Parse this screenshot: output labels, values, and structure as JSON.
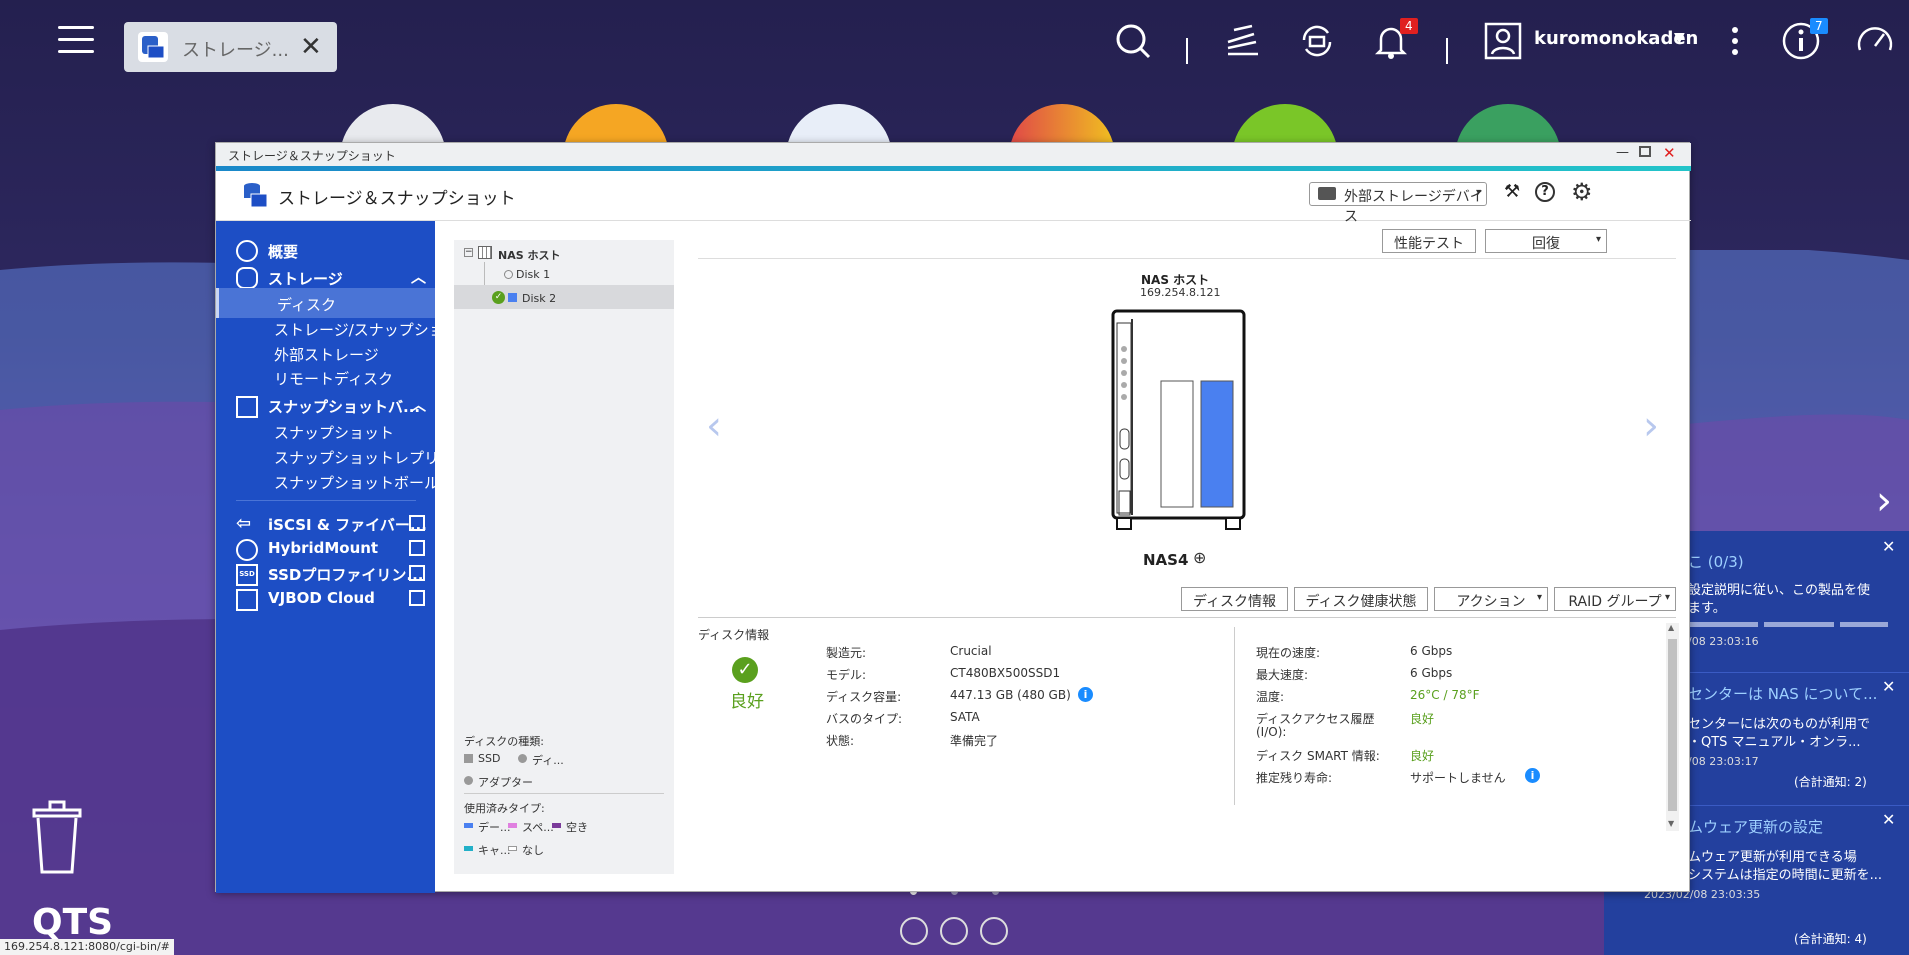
{
  "desktop": {
    "tab_label": "ストレージ...",
    "user_name": "kuromonokaden",
    "notification_count": "4",
    "info_count": "7",
    "status_url": "169.254.8.121:8080/cgi-bin/#",
    "qts_label": "QTS",
    "icons": [
      "menu-icon",
      "search-icon",
      "tasks-icon",
      "sync-icon",
      "bell-icon",
      "user-icon",
      "more-icon",
      "info-icon",
      "dashboard-icon",
      "trash-icon"
    ]
  },
  "window": {
    "title": "ストレージ＆スナップショット",
    "app_title": "ストレージ＆スナップショット",
    "external_dropdown": "外部ストレージデバイス"
  },
  "sidebar": {
    "overview": "概要",
    "storage": "ストレージ",
    "disk": "ディスク",
    "storage_snapshot": "ストレージ/スナップショ...",
    "external_storage": "外部ストレージ",
    "remote_disk": "リモートディスク",
    "snapshot_backup": "スナップショットバ...",
    "snapshot": "スナップショット",
    "snapshot_replica": "スナップショットレプリカ",
    "snapshot_vault": "スナップショットボールト",
    "iscsi": "iSCSI & ファイバー...",
    "hybridmount": "HybridMount",
    "ssd_profiling": "SSDプロファイリン...",
    "vjbod": "VJBOD Cloud"
  },
  "tree": {
    "root": "NAS ホスト",
    "disk1": "Disk 1",
    "disk2": "Disk 2",
    "disk_type_title": "ディスクの種類:",
    "ssd": "SSD",
    "di": "ディ...",
    "adapter": "アダプター",
    "used_type_title": "使用済みタイプ:",
    "data": "デー...",
    "spare": "スペ...",
    "free": "空き",
    "cache": "キャ...",
    "none": "なし"
  },
  "main": {
    "perf_test": "性能テスト",
    "recover": "回復",
    "nas_host": "NAS ホスト",
    "ip": "169.254.8.121",
    "nas_name": "NAS4",
    "btn_disk_info": "ディスク情報",
    "btn_disk_health": "ディスク健康状態",
    "btn_action": "アクション",
    "btn_raid": "RAID グループ",
    "section_title": "ディスク情報",
    "status_good": "良好",
    "left_labels": [
      "製造元:",
      "モデル:",
      "ディスク容量:",
      "バスのタイプ:",
      "状態:"
    ],
    "left_values": [
      "Crucial",
      "CT480BX500SSD1",
      "447.13 GB (480 GB)",
      "SATA",
      "準備完了"
    ],
    "right_labels": [
      "現在の速度:",
      "最大速度:",
      "温度:",
      "ディスクアクセス履歴",
      "(I/O):",
      "ディスク SMART 情報:",
      "推定残り寿命:"
    ],
    "right_values": [
      "6 Gbps",
      "6 Gbps",
      "26°C / 78°F",
      "良好",
      "良好",
      "サポートしません"
    ]
  },
  "notifications": [
    {
      "title": "こ (0/3)",
      "text1": "設定説明に従い、この製品を使",
      "text2": "ます。",
      "time": "/08 23:03:16"
    },
    {
      "title": "センターは NAS について...",
      "text1": "センターには次のものが利用で",
      "text2": "・QTS マニュアル・オンラ...",
      "time": "/08 23:03:17",
      "count": "(合計通知: 2)"
    },
    {
      "title": "ムウェア更新の設定",
      "text1": "ムウェア更新が利用できる場",
      "text2": "システムは指定の時間に更新を...",
      "time": "2023/02/08 23:03:35",
      "count": "(合計通知: 4)"
    }
  ],
  "colors": {
    "sidebar": "#1d4ec5",
    "accent": "#1a88c9",
    "good": "#5aa01e",
    "disk2": "#4a80f0"
  }
}
